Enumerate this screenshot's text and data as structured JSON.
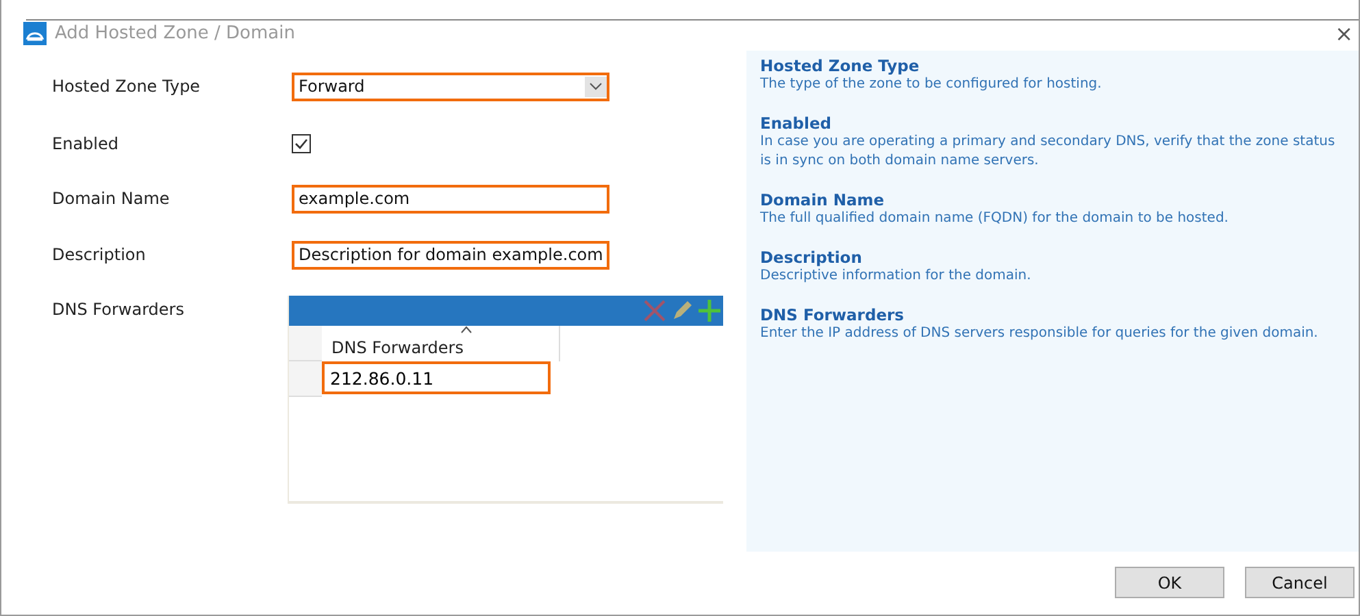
{
  "window": {
    "title": "Add Hosted Zone / Domain",
    "close": "×"
  },
  "form": {
    "zone_type": {
      "label": "Hosted Zone Type",
      "value": "Forward"
    },
    "enabled": {
      "label": "Enabled",
      "checked": true
    },
    "domain_name": {
      "label": "Domain Name",
      "value": "example.com"
    },
    "description": {
      "label": "Description",
      "value": "Description for domain example.com"
    },
    "dns_forwarders": {
      "label": "DNS Forwarders",
      "column": "DNS Forwarders",
      "rows": [
        "212.86.0.11"
      ]
    }
  },
  "help": [
    {
      "title": "Hosted Zone Type",
      "text": "The type of the zone to be configured for hosting."
    },
    {
      "title": "Enabled",
      "text": "In case you are operating a primary and secondary DNS, verify that the zone status is in sync on both domain name servers."
    },
    {
      "title": "Domain Name",
      "text": "The full qualified domain name (FQDN) for the domain to be hosted."
    },
    {
      "title": "Description",
      "text": "Descriptive information for the domain."
    },
    {
      "title": "DNS Forwarders",
      "text": "Enter the IP address of DNS servers responsible for queries for the given domain."
    }
  ],
  "buttons": [
    "OK",
    "Cancel"
  ]
}
